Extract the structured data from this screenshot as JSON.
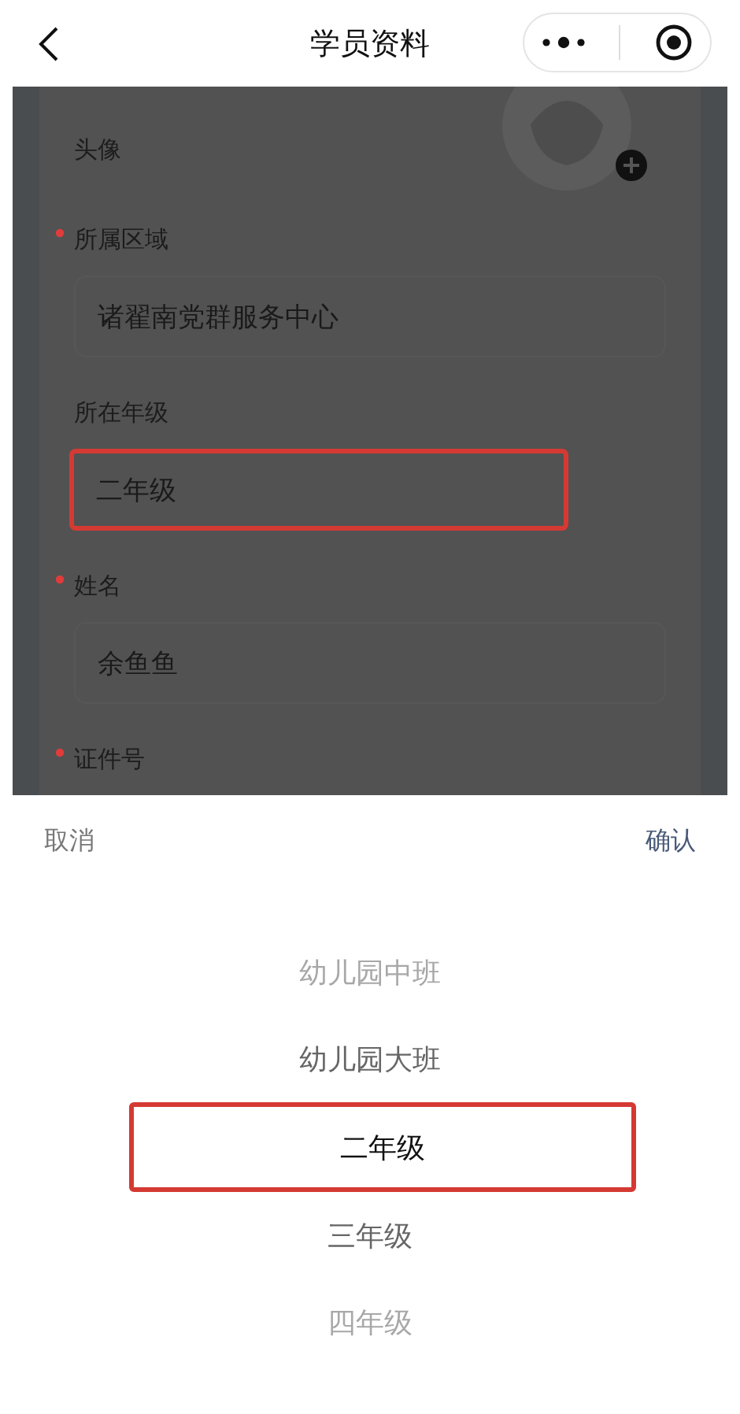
{
  "nav": {
    "title": "学员资料"
  },
  "form": {
    "avatar": {
      "label": "头像"
    },
    "fields": [
      {
        "label": "所属区域",
        "required": true,
        "value": "诸翟南党群服务中心",
        "highlighted": false
      },
      {
        "label": "所在年级",
        "required": false,
        "value": "二年级",
        "highlighted": true
      },
      {
        "label": "姓名",
        "required": true,
        "value": "余鱼鱼",
        "highlighted": false
      },
      {
        "label": "证件号",
        "required": true
      }
    ]
  },
  "picker": {
    "cancel": "取消",
    "confirm": "确认",
    "highlighted": true,
    "options": [
      {
        "label": "幼儿园中班",
        "selected": false
      },
      {
        "label": "幼儿园大班",
        "selected": false
      },
      {
        "label": "二年级",
        "selected": true
      },
      {
        "label": "三年级",
        "selected": false
      },
      {
        "label": "四年级",
        "selected": false
      }
    ]
  }
}
